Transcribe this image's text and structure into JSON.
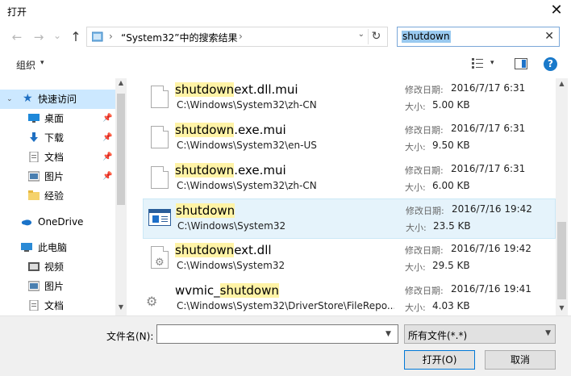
{
  "window": {
    "title": "打开",
    "close_label": "✕"
  },
  "nav": {
    "back": "←",
    "forward": "→",
    "dropdown": "⌄",
    "up": "↑"
  },
  "address": {
    "sep": "›",
    "text": "“System32”中的搜索结果",
    "dropdown": "⌄",
    "refresh": "↻"
  },
  "search": {
    "value": "shutdown",
    "clear": "✕"
  },
  "toolbar": {
    "organize": "组织",
    "caret": "▾"
  },
  "navpane": {
    "quick_access": "快速访问",
    "items": [
      {
        "label": "桌面",
        "pinned": true
      },
      {
        "label": "下载",
        "pinned": true
      },
      {
        "label": "文档",
        "pinned": true
      },
      {
        "label": "图片",
        "pinned": true
      },
      {
        "label": "经验",
        "pinned": false
      }
    ],
    "onedrive": "OneDrive",
    "this_pc": "此电脑",
    "pc_items": [
      {
        "label": "视频"
      },
      {
        "label": "图片"
      },
      {
        "label": "文档"
      }
    ]
  },
  "results": [
    {
      "name_hl": "shutdown",
      "name_rest": "ext.dll.mui",
      "name_pre": "",
      "path": "C:\\Windows\\System32\\zh-CN",
      "mod_label": "修改日期:",
      "mod": "2016/7/17 6:31",
      "size_label": "大小:",
      "size": "5.00 KB",
      "icon": "doc-icon"
    },
    {
      "name_hl": "shutdown",
      "name_rest": ".exe.mui",
      "name_pre": "",
      "path": "C:\\Windows\\System32\\en-US",
      "mod_label": "修改日期:",
      "mod": "2016/7/17 6:31",
      "size_label": "大小:",
      "size": "9.50 KB",
      "icon": "doc-icon"
    },
    {
      "name_hl": "shutdown",
      "name_rest": ".exe.mui",
      "name_pre": "",
      "path": "C:\\Windows\\System32\\zh-CN",
      "mod_label": "修改日期:",
      "mod": "2016/7/17 6:31",
      "size_label": "大小:",
      "size": "6.00 KB",
      "icon": "doc-icon"
    },
    {
      "name_hl": "shutdown",
      "name_rest": "",
      "name_pre": "",
      "path": "C:\\Windows\\System32",
      "mod_label": "修改日期:",
      "mod": "2016/7/16 19:42",
      "size_label": "大小:",
      "size": "23.5 KB",
      "icon": "exe-icon"
    },
    {
      "name_hl": "shutdown",
      "name_rest": "ext.dll",
      "name_pre": "",
      "path": "C:\\Windows\\System32",
      "mod_label": "修改日期:",
      "mod": "2016/7/16 19:42",
      "size_label": "大小:",
      "size": "29.5 KB",
      "icon": "dll-icon"
    },
    {
      "name_hl": "shutdown",
      "name_rest": "",
      "name_pre": "wvmic_",
      "path": "C:\\Windows\\System32\\DriverStore\\FileRepo...",
      "mod_label": "修改日期:",
      "mod": "2016/7/16 19:41",
      "size_label": "大小:",
      "size": "4.03 KB",
      "icon": "gear-icon"
    }
  ],
  "bottom": {
    "filename_label": "文件名(N):",
    "filename_value": "",
    "filetype": "所有文件(*.*)",
    "open": "打开(O)",
    "cancel": "取消"
  }
}
